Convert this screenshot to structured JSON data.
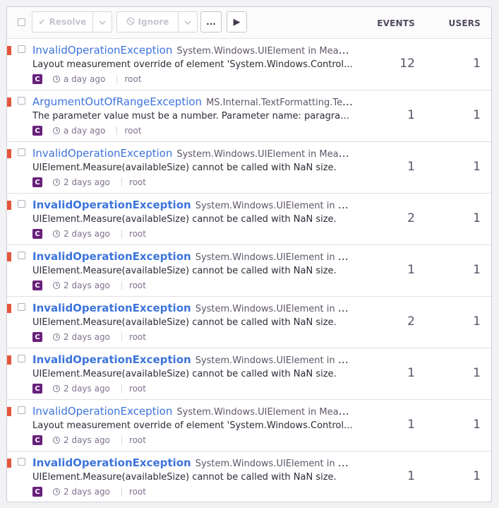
{
  "toolbar": {
    "resolve_label": "Resolve",
    "ignore_label": "Ignore",
    "more_label": "...",
    "play_label": "▶",
    "events_header": "EVENTS",
    "users_header": "USERS"
  },
  "colors": {
    "level_error": "#e4563a",
    "link": "#3d74db",
    "platform": "#68217a"
  },
  "issues": [
    {
      "type": "InvalidOperationException",
      "culprit": "System.Windows.UIElement in MeasureCore",
      "message": "Layout measurement override of element 'System.Windows.Controls.ScrollViewer' should not return NaN values as its DesiredSize.",
      "platform": "C",
      "time": "a day ago",
      "user": "root",
      "events": "12",
      "users": "1",
      "bold": false
    },
    {
      "type": "ArgumentOutOfRangeException",
      "culprit": "MS.Internal.TextFormatting.TextFormatterImp in FormatLine",
      "message": "The parameter value must be a number. Parameter name: paragraphWidth",
      "platform": "C",
      "time": "a day ago",
      "user": "root",
      "events": "1",
      "users": "1",
      "bold": false
    },
    {
      "type": "InvalidOperationException",
      "culprit": "System.Windows.UIElement in MeasureCore",
      "message": "UIElement.Measure(availableSize) cannot be called with NaN size.",
      "platform": "C",
      "time": "2 days ago",
      "user": "root",
      "events": "1",
      "users": "1",
      "bold": false
    },
    {
      "type": "InvalidOperationException",
      "culprit": "System.Windows.UIElement in MeasureCore",
      "message": "UIElement.Measure(availableSize) cannot be called with NaN size.",
      "platform": "C",
      "time": "2 days ago",
      "user": "root",
      "events": "2",
      "users": "1",
      "bold": true
    },
    {
      "type": "InvalidOperationException",
      "culprit": "System.Windows.UIElement in MeasureCore",
      "message": "UIElement.Measure(availableSize) cannot be called with NaN size.",
      "platform": "C",
      "time": "2 days ago",
      "user": "root",
      "events": "1",
      "users": "1",
      "bold": true
    },
    {
      "type": "InvalidOperationException",
      "culprit": "System.Windows.UIElement in MeasureCore",
      "message": "UIElement.Measure(availableSize) cannot be called with NaN size.",
      "platform": "C",
      "time": "2 days ago",
      "user": "root",
      "events": "2",
      "users": "1",
      "bold": true
    },
    {
      "type": "InvalidOperationException",
      "culprit": "System.Windows.UIElement in MeasureCore",
      "message": "UIElement.Measure(availableSize) cannot be called with NaN size.",
      "platform": "C",
      "time": "2 days ago",
      "user": "root",
      "events": "1",
      "users": "1",
      "bold": true
    },
    {
      "type": "InvalidOperationException",
      "culprit": "System.Windows.UIElement in MeasureCore",
      "message": "Layout measurement override of element 'System.Windows.Controls.ScrollViewer' should not return NaN values as its DesiredSize.",
      "platform": "C",
      "time": "2 days ago",
      "user": "root",
      "events": "1",
      "users": "1",
      "bold": false
    },
    {
      "type": "InvalidOperationException",
      "culprit": "System.Windows.UIElement in MeasureCore",
      "message": "UIElement.Measure(availableSize) cannot be called with NaN size.",
      "platform": "C",
      "time": "2 days ago",
      "user": "root",
      "events": "1",
      "users": "1",
      "bold": true
    }
  ]
}
